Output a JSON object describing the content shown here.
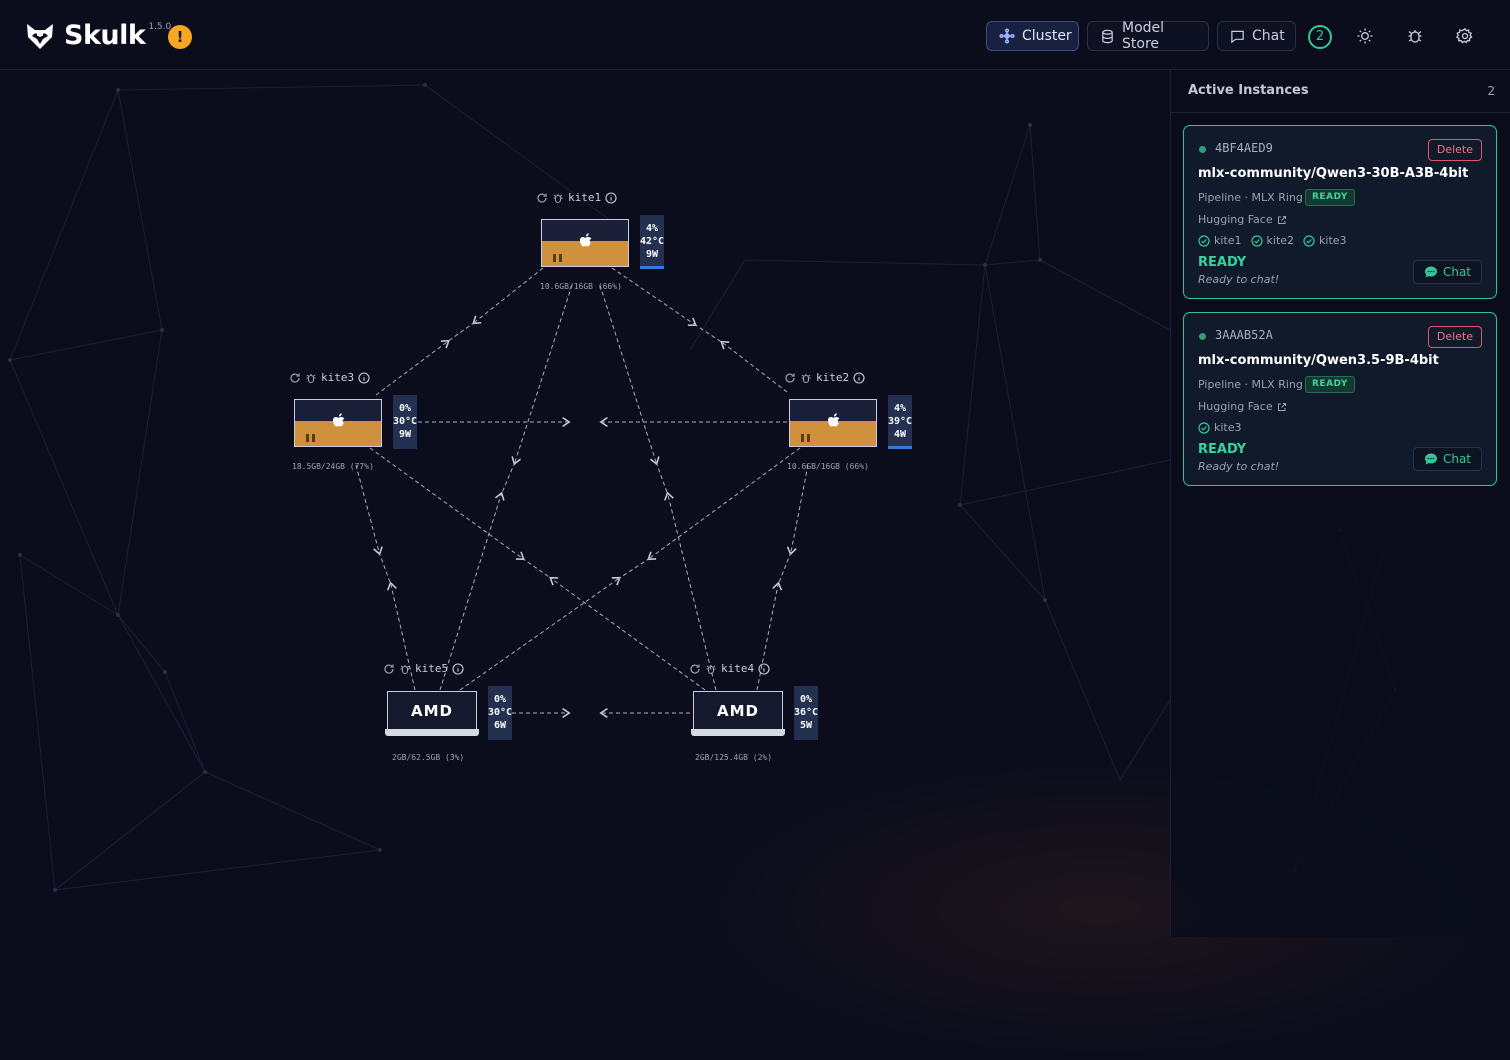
{
  "app": {
    "name": "Skulk",
    "version": "1.5.0",
    "warning_icon": "!"
  },
  "nav": {
    "cluster": "Cluster",
    "model_store": "Model Store",
    "chat": "Chat",
    "badge_count": "2"
  },
  "sidebar": {
    "title": "Active Instances",
    "count": "2",
    "instances": [
      {
        "id": "4BF4AED9",
        "delete_label": "Delete",
        "model": "mlx-community/Qwen3-30B-A3B-4bit",
        "pipeline": "Pipeline · MLX Ring",
        "badge": "READY",
        "source": "Hugging Face",
        "nodes": [
          "kite1",
          "kite2",
          "kite3"
        ],
        "status": "READY",
        "status_sub": "Ready to chat!",
        "chat_label": "Chat"
      },
      {
        "id": "3AAAB52A",
        "delete_label": "Delete",
        "model": "mlx-community/Qwen3.5-9B-4bit",
        "pipeline": "Pipeline · MLX Ring",
        "badge": "READY",
        "source": "Hugging Face",
        "nodes": [
          "kite3"
        ],
        "status": "READY",
        "status_sub": "Ready to chat!",
        "chat_label": "Chat"
      }
    ]
  },
  "topology": {
    "nodes": [
      {
        "name": "kite1",
        "type": "mac",
        "util": "4%",
        "temp": "42°C",
        "power": "9W",
        "memory": "10.6GB/16GB (66%)"
      },
      {
        "name": "kite2",
        "type": "mac",
        "util": "4%",
        "temp": "39°C",
        "power": "4W",
        "memory": "10.6GB/16GB (66%)"
      },
      {
        "name": "kite3",
        "type": "mac",
        "util": "0%",
        "temp": "30°C",
        "power": "9W",
        "memory": "18.5GB/24GB (77%)"
      },
      {
        "name": "kite4",
        "type": "amd",
        "brand": "AMD",
        "util": "0%",
        "temp": "36°C",
        "power": "5W",
        "memory": "2GB/125.4GB (2%)"
      },
      {
        "name": "kite5",
        "type": "amd",
        "brand": "AMD",
        "util": "0%",
        "temp": "30°C",
        "power": "6W",
        "memory": "2GB/62.5GB (3%)"
      }
    ]
  },
  "colors": {
    "accent_green": "#35c79a",
    "warning": "#f5a623",
    "delete": "#e05569",
    "mac_body": "#cf913e"
  }
}
